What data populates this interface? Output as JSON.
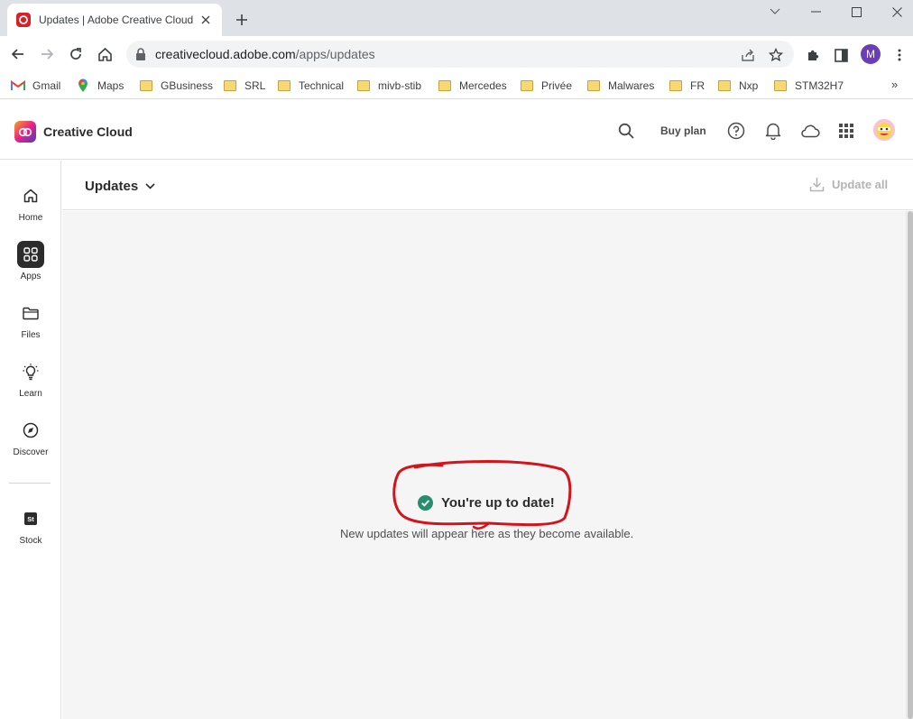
{
  "browser": {
    "tab_title": "Updates | Adobe Creative Cloud",
    "url_host": "creativecloud.adobe.com",
    "url_path": "/apps/updates",
    "profile_initial": "M",
    "bookmarks": [
      {
        "label": "Gmail",
        "icon": "gmail-icon"
      },
      {
        "label": "Maps",
        "icon": "maps-icon"
      },
      {
        "label": "GBusiness",
        "icon": "folder-icon"
      },
      {
        "label": "SRL",
        "icon": "folder-icon"
      },
      {
        "label": "Technical",
        "icon": "folder-icon"
      },
      {
        "label": "mivb-stib",
        "icon": "folder-icon"
      },
      {
        "label": "Mercedes",
        "icon": "folder-icon"
      },
      {
        "label": "Privée",
        "icon": "folder-icon"
      },
      {
        "label": "Malwares",
        "icon": "folder-icon"
      },
      {
        "label": "FR",
        "icon": "folder-icon"
      },
      {
        "label": "Nxp",
        "icon": "folder-icon"
      },
      {
        "label": "STM32H7",
        "icon": "folder-icon"
      }
    ],
    "bookmarks_more": "»"
  },
  "app": {
    "brand": "Creative Cloud",
    "buy_plan": "Buy plan",
    "nav": [
      {
        "label": "Home",
        "icon": "home-icon",
        "active": false
      },
      {
        "label": "Apps",
        "icon": "apps-grid-icon",
        "active": true
      },
      {
        "label": "Files",
        "icon": "folder-icon",
        "active": false
      },
      {
        "label": "Learn",
        "icon": "lightbulb-icon",
        "active": false
      },
      {
        "label": "Discover",
        "icon": "compass-icon",
        "active": false
      },
      {
        "label": "Stock",
        "icon": "stock-icon",
        "active": false
      }
    ],
    "stock_badge": "St",
    "page_title": "Updates",
    "update_all": "Update all",
    "status_title": "You're up to date!",
    "status_subtitle": "New updates will appear here as they become available."
  },
  "colors": {
    "status_check": "#268e6c",
    "annotation": "#d4141c",
    "active_nav_bg": "#2c2c2c"
  }
}
